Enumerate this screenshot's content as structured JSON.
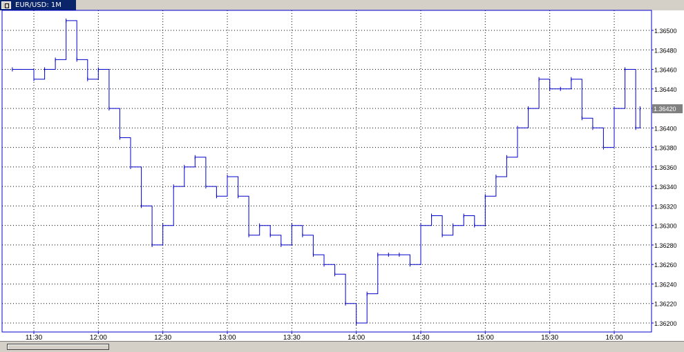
{
  "tab": {
    "title": "EUR/USD: 1M"
  },
  "chart_data": {
    "type": "line",
    "symbol": "EUR/USD",
    "timeframe": "1M",
    "current_price": "1.36420",
    "x_tick_labels": [
      "11:30",
      "12:00",
      "12:30",
      "13:00",
      "13:30",
      "14:00",
      "14:30",
      "15:00",
      "15:30",
      "16:00"
    ],
    "y_tick_labels": [
      "1.36500",
      "1.36480",
      "1.36460",
      "1.36440",
      "1.36420",
      "1.36400",
      "1.36380",
      "1.36360",
      "1.36340",
      "1.36320",
      "1.36300",
      "1.36280",
      "1.36260",
      "1.36240",
      "1.36220",
      "1.36200"
    ],
    "ylim": [
      1.362,
      1.365
    ],
    "grid": true,
    "line_color": "#0000cc",
    "bars": [
      {
        "t": "11:20",
        "price": 1.3646
      },
      {
        "t": "11:30",
        "price": 1.3645
      },
      {
        "t": "11:35",
        "price": 1.3646
      },
      {
        "t": "11:40",
        "price": 1.3647
      },
      {
        "t": "11:45",
        "price": 1.3651
      },
      {
        "t": "11:50",
        "price": 1.3647
      },
      {
        "t": "11:55",
        "price": 1.3645
      },
      {
        "t": "12:00",
        "price": 1.3646
      },
      {
        "t": "12:05",
        "price": 1.3642
      },
      {
        "t": "12:10",
        "price": 1.3639
      },
      {
        "t": "12:15",
        "price": 1.3636
      },
      {
        "t": "12:20",
        "price": 1.3632
      },
      {
        "t": "12:25",
        "price": 1.3628
      },
      {
        "t": "12:30",
        "price": 1.363
      },
      {
        "t": "12:35",
        "price": 1.3634
      },
      {
        "t": "12:40",
        "price": 1.3636
      },
      {
        "t": "12:45",
        "price": 1.3637
      },
      {
        "t": "12:50",
        "price": 1.3634
      },
      {
        "t": "12:55",
        "price": 1.3633
      },
      {
        "t": "13:00",
        "price": 1.3635
      },
      {
        "t": "13:05",
        "price": 1.3633
      },
      {
        "t": "13:10",
        "price": 1.3629
      },
      {
        "t": "13:15",
        "price": 1.363
      },
      {
        "t": "13:20",
        "price": 1.3629
      },
      {
        "t": "13:25",
        "price": 1.3628
      },
      {
        "t": "13:30",
        "price": 1.363
      },
      {
        "t": "13:35",
        "price": 1.3629
      },
      {
        "t": "13:40",
        "price": 1.3627
      },
      {
        "t": "13:45",
        "price": 1.3626
      },
      {
        "t": "13:50",
        "price": 1.3625
      },
      {
        "t": "13:55",
        "price": 1.3622
      },
      {
        "t": "14:00",
        "price": 1.362
      },
      {
        "t": "14:05",
        "price": 1.3623
      },
      {
        "t": "14:10",
        "price": 1.3627
      },
      {
        "t": "14:15",
        "price": 1.3627
      },
      {
        "t": "14:20",
        "price": 1.3627
      },
      {
        "t": "14:25",
        "price": 1.3626
      },
      {
        "t": "14:30",
        "price": 1.363
      },
      {
        "t": "14:35",
        "price": 1.3631
      },
      {
        "t": "14:40",
        "price": 1.3629
      },
      {
        "t": "14:45",
        "price": 1.363
      },
      {
        "t": "14:50",
        "price": 1.3631
      },
      {
        "t": "14:55",
        "price": 1.363
      },
      {
        "t": "15:00",
        "price": 1.3633
      },
      {
        "t": "15:05",
        "price": 1.3635
      },
      {
        "t": "15:10",
        "price": 1.3637
      },
      {
        "t": "15:15",
        "price": 1.364
      },
      {
        "t": "15:20",
        "price": 1.3642
      },
      {
        "t": "15:25",
        "price": 1.3645
      },
      {
        "t": "15:30",
        "price": 1.3644
      },
      {
        "t": "15:35",
        "price": 1.3644
      },
      {
        "t": "15:40",
        "price": 1.3645
      },
      {
        "t": "15:45",
        "price": 1.3641
      },
      {
        "t": "15:50",
        "price": 1.364
      },
      {
        "t": "15:55",
        "price": 1.3638
      },
      {
        "t": "16:00",
        "price": 1.3642
      },
      {
        "t": "16:05",
        "price": 1.3646
      },
      {
        "t": "16:10",
        "price": 1.364
      },
      {
        "t": "16:12",
        "price": 1.3642
      }
    ]
  }
}
